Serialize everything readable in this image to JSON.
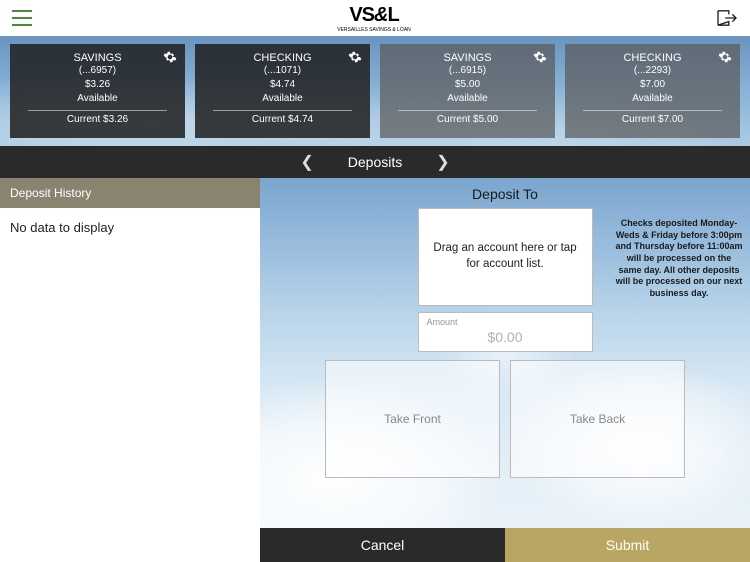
{
  "header": {
    "logo_main": "VS",
    "logo_amp": "&",
    "logo_end": "L",
    "logo_sub": "VERSAILLES SAVINGS & LOAN"
  },
  "accounts": [
    {
      "type": "SAVINGS",
      "mask": "(...6957)",
      "amount": "$3.26",
      "status": "Available",
      "current_label": "Current $3.26",
      "shade": "dark"
    },
    {
      "type": "CHECKING",
      "mask": "(...1071)",
      "amount": "$4.74",
      "status": "Available",
      "current_label": "Current $4.74",
      "shade": "dark"
    },
    {
      "type": "SAVINGS",
      "mask": "(...6915)",
      "amount": "$5.00",
      "status": "Available",
      "current_label": "Current $5.00",
      "shade": "light"
    },
    {
      "type": "CHECKING",
      "mask": "(...2293)",
      "amount": "$7.00",
      "status": "Available",
      "current_label": "Current $7.00",
      "shade": "light"
    }
  ],
  "tabbar": {
    "title": "Deposits"
  },
  "history": {
    "header": "Deposit History",
    "empty": "No data to display"
  },
  "deposit": {
    "title": "Deposit To",
    "dropzone": "Drag an account here or tap for account list.",
    "notice": "Checks deposited Monday-Weds & Friday before 3:00pm and Thursday before 11:00am will be processed on the same day. All other deposits will be processed on our next business day.",
    "amount_label": "Amount",
    "amount_value": "$0.00",
    "take_front": "Take Front",
    "take_back": "Take Back",
    "cancel": "Cancel",
    "submit": "Submit"
  }
}
